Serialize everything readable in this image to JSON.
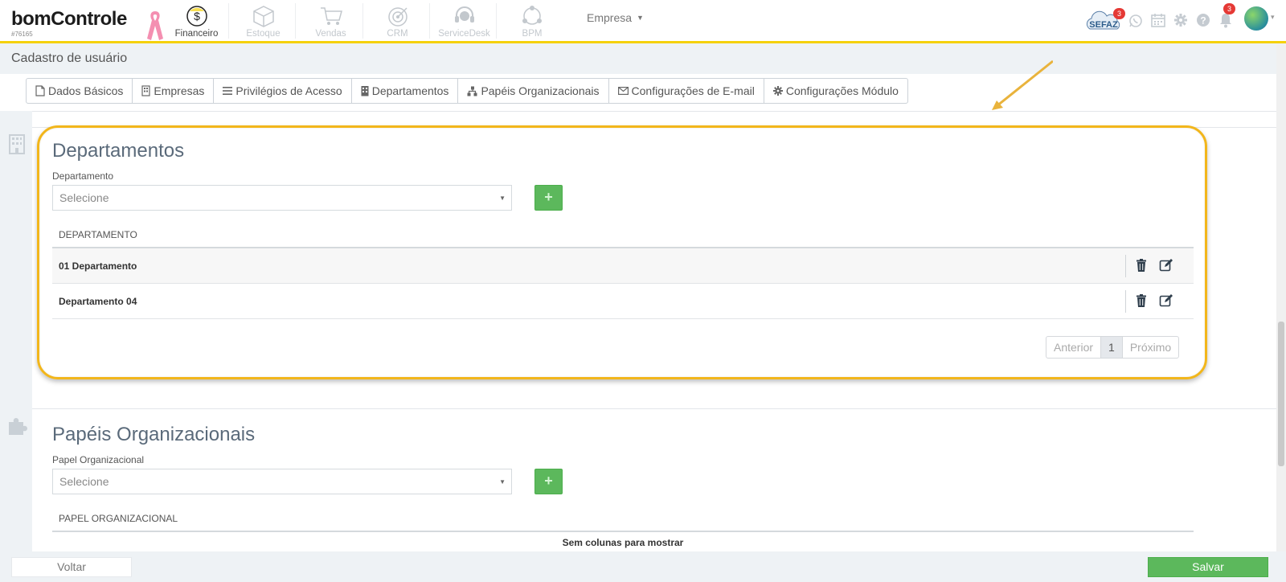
{
  "brand": {
    "logo_text": "bomControle",
    "account_id": "#76165"
  },
  "nav": {
    "modules": [
      {
        "label": "Financeiro",
        "icon": "dollar-coin-icon",
        "active": true
      },
      {
        "label": "Estoque",
        "icon": "box-icon",
        "active": false
      },
      {
        "label": "Vendas",
        "icon": "cart-icon",
        "active": false
      },
      {
        "label": "CRM",
        "icon": "target-icon",
        "active": false
      },
      {
        "label": "ServiceDesk",
        "icon": "headset-icon",
        "active": false
      },
      {
        "label": "BPM",
        "icon": "process-cycle-icon",
        "active": false
      }
    ],
    "company_select": "Empresa"
  },
  "header_icons": {
    "sefaz_label": "SEFAZ",
    "sefaz_badge": "3",
    "notifications_badge": "3"
  },
  "page": {
    "title": "Cadastro de usuário"
  },
  "tabs": [
    {
      "label": "Dados Básicos",
      "icon": "file-icon"
    },
    {
      "label": "Empresas",
      "icon": "building-icon"
    },
    {
      "label": "Privilégios de Acesso",
      "icon": "list-icon"
    },
    {
      "label": "Departamentos",
      "icon": "building-icon"
    },
    {
      "label": "Papéis Organizacionais",
      "icon": "sitemap-icon"
    },
    {
      "label": "Configurações de E-mail",
      "icon": "envelope-icon"
    },
    {
      "label": "Configurações Módulo",
      "icon": "gear-icon"
    }
  ],
  "departamentos": {
    "title": "Departamentos",
    "field_label": "Departamento",
    "select_placeholder": "Selecione",
    "add_label": "+",
    "column_header": "DEPARTAMENTO",
    "rows": [
      "01 Departamento",
      "Departamento 04"
    ],
    "pager": {
      "prev": "Anterior",
      "current": "1",
      "next": "Próximo"
    }
  },
  "papeis": {
    "title": "Papéis Organizacionais",
    "field_label": "Papel Organizacional",
    "select_placeholder": "Selecione",
    "add_label": "+",
    "column_header": "PAPEL ORGANIZACIONAL",
    "empty_message": "Sem colunas para mostrar"
  },
  "footer": {
    "back_label": "Voltar",
    "save_label": "Salvar"
  },
  "colors": {
    "accent_yellow": "#f5d10a",
    "highlight": "#f2b61b",
    "success": "#5cb85c",
    "badge": "#e53935"
  }
}
